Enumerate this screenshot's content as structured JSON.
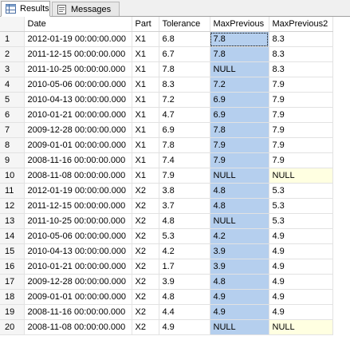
{
  "tabs": [
    {
      "label": "Results",
      "icon": "results-grid-icon",
      "active": true
    },
    {
      "label": "Messages",
      "icon": "messages-icon",
      "active": false
    }
  ],
  "columns": [
    "",
    "Date",
    "Part",
    "Tolerance",
    "MaxPrevious",
    "MaxPrevious2"
  ],
  "rows": [
    [
      "1",
      "2012-01-19 00:00:00.000",
      "X1",
      "6.8",
      "7.8",
      "8.3"
    ],
    [
      "2",
      "2011-12-15 00:00:00.000",
      "X1",
      "6.7",
      "7.8",
      "8.3"
    ],
    [
      "3",
      "2011-10-25 00:00:00.000",
      "X1",
      "7.8",
      "NULL",
      "8.3"
    ],
    [
      "4",
      "2010-05-06 00:00:00.000",
      "X1",
      "8.3",
      "7.2",
      "7.9"
    ],
    [
      "5",
      "2010-04-13 00:00:00.000",
      "X1",
      "7.2",
      "6.9",
      "7.9"
    ],
    [
      "6",
      "2010-01-21 00:00:00.000",
      "X1",
      "4.7",
      "6.9",
      "7.9"
    ],
    [
      "7",
      "2009-12-28 00:00:00.000",
      "X1",
      "6.9",
      "7.8",
      "7.9"
    ],
    [
      "8",
      "2009-01-01 00:00:00.000",
      "X1",
      "7.8",
      "7.9",
      "7.9"
    ],
    [
      "9",
      "2008-11-16 00:00:00.000",
      "X1",
      "7.4",
      "7.9",
      "7.9"
    ],
    [
      "10",
      "2008-11-08 00:00:00.000",
      "X1",
      "7.9",
      "NULL",
      "NULL"
    ],
    [
      "11",
      "2012-01-19 00:00:00.000",
      "X2",
      "3.8",
      "4.8",
      "5.3"
    ],
    [
      "12",
      "2011-12-15 00:00:00.000",
      "X2",
      "3.7",
      "4.8",
      "5.3"
    ],
    [
      "13",
      "2011-10-25 00:00:00.000",
      "X2",
      "4.8",
      "NULL",
      "5.3"
    ],
    [
      "14",
      "2010-05-06 00:00:00.000",
      "X2",
      "5.3",
      "4.2",
      "4.9"
    ],
    [
      "15",
      "2010-04-13 00:00:00.000",
      "X2",
      "4.2",
      "3.9",
      "4.9"
    ],
    [
      "16",
      "2010-01-21 00:00:00.000",
      "X2",
      "1.7",
      "3.9",
      "4.9"
    ],
    [
      "17",
      "2009-12-28 00:00:00.000",
      "X2",
      "3.9",
      "4.8",
      "4.9"
    ],
    [
      "18",
      "2009-01-01 00:00:00.000",
      "X2",
      "4.8",
      "4.9",
      "4.9"
    ],
    [
      "19",
      "2008-11-16 00:00:00.000",
      "X2",
      "4.4",
      "4.9",
      "4.9"
    ],
    [
      "20",
      "2008-11-08 00:00:00.000",
      "X2",
      "4.9",
      "NULL",
      "NULL"
    ]
  ],
  "colors": {
    "selected_column": "#b5cfee",
    "null_cell": "#ffffe1"
  }
}
